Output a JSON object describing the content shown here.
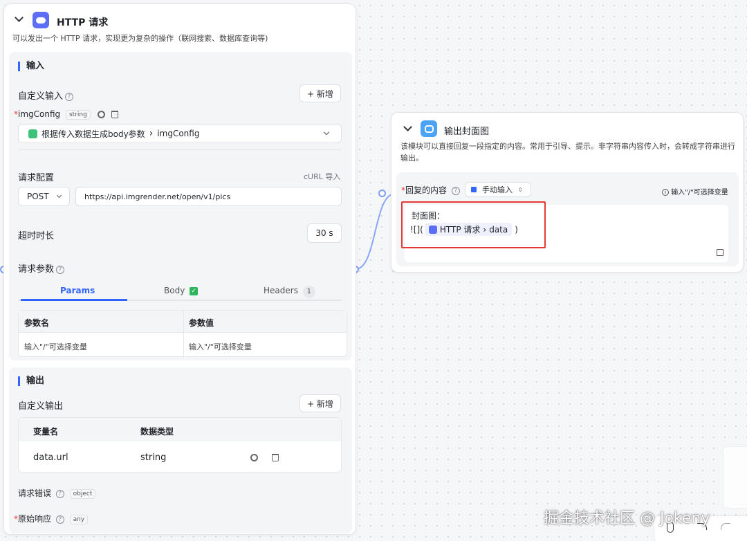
{
  "http_node": {
    "title": "HTTP 请求",
    "description": "可以发出一个 HTTP 请求，实现更为复杂的操作（联网搜索、数据库查询等)",
    "input": {
      "section_title": "输入",
      "custom_input_label": "自定义输入",
      "add_button": "+ 新增",
      "param_name": "imgConfig",
      "param_type": "string",
      "source_path": "根据传入数据生成body参数",
      "source_sep": "›",
      "source_var": "imgConfig",
      "request_config_label": "请求配置",
      "curl_import": "cURL 导入",
      "method": "POST",
      "url": "https://api.imgrender.net/open/v1/pics",
      "timeout_label": "超时时长",
      "timeout_value": "30 s",
      "request_params_label": "请求参数",
      "tabs": {
        "params": "Params",
        "body": "Body",
        "headers": "Headers",
        "headers_count": "1"
      },
      "table": {
        "col1": "参数名",
        "col2": "参数值",
        "placeholder1": "输入\"/\"可选择变量",
        "placeholder2": "输入\"/\"可选择变量"
      }
    },
    "output": {
      "section_title": "输出",
      "custom_output_label": "自定义输出",
      "add_button": "+ 新增",
      "col_var": "变量名",
      "col_type": "数据类型",
      "row_var": "data.url",
      "row_type": "string",
      "error_label": "请求错误",
      "error_type": "object",
      "raw_label": "原始响应",
      "raw_type": "any"
    }
  },
  "output_node": {
    "title": "输出封面图",
    "description": "该模块可以直接回复一段指定的内容。常用于引导、提示。非字符串内容传入时，会转成字符串进行输出。",
    "reply_label": "回复的内容",
    "mode": "手动输入",
    "hint": "输入\"/\"可选择变量",
    "content_line1": "封面图：",
    "content_prefix": "![](",
    "var_node": "HTTP 请求",
    "var_sep": "›",
    "var_name": "data",
    "content_suffix": ")"
  },
  "watermark": "掘金技术社区 @ Jokeny"
}
